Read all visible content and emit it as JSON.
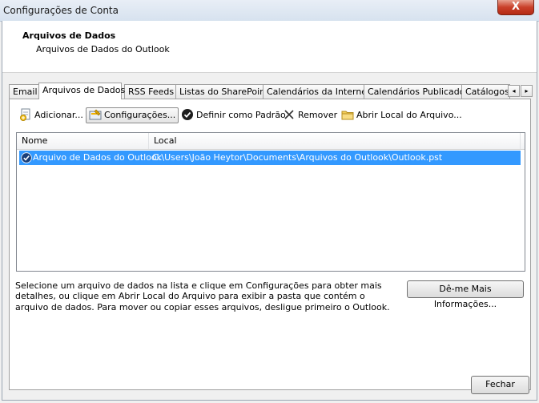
{
  "window": {
    "title": "Configurações de Conta",
    "close_glyph": "X"
  },
  "header": {
    "title": "Arquivos de Dados",
    "subtitle": "Arquivos de Dados do Outlook"
  },
  "tabs": [
    {
      "label": "Email",
      "active": false
    },
    {
      "label": "Arquivos de Dados",
      "active": true
    },
    {
      "label": "RSS Feeds",
      "active": false
    },
    {
      "label": "Listas do SharePoint",
      "active": false
    },
    {
      "label": "Calendários da Internet",
      "active": false
    },
    {
      "label": "Calendários Publicados",
      "active": false
    },
    {
      "label": "Catálogos",
      "active": false
    }
  ],
  "tab_scroll": {
    "left": "◂",
    "right": "▸"
  },
  "toolbar": {
    "add": {
      "label": "Adicionar...",
      "icon": "add-file-icon"
    },
    "settings": {
      "label": "Configurações...",
      "icon": "settings-icon"
    },
    "set_default": {
      "label": "Definir como Padrão",
      "icon": "check-circle-icon"
    },
    "remove": {
      "label": "Remover",
      "icon": "x-icon"
    },
    "open_location": {
      "label": "Abrir Local do Arquivo...",
      "icon": "folder-icon"
    }
  },
  "list": {
    "columns": [
      "Nome",
      "Local"
    ],
    "rows": [
      {
        "name": "Arquivo de Dados do Outlook",
        "location": "C:\\Users\\João Heytor\\Documents\\Arquivos do Outlook\\Outlook.pst",
        "default": true,
        "selected": true
      }
    ]
  },
  "info_text": "Selecione um arquivo de dados na lista e clique em Configurações para obter mais detalhes, ou clique em Abrir Local do Arquivo para exibir a pasta que contém o arquivo de dados. Para mover ou copiar esses arquivos, desligue primeiro o Outlook.",
  "buttons": {
    "more_info": "Dê-me Mais Informações...",
    "close": "Fechar"
  },
  "colors": {
    "selection": "#3399ff",
    "close_button": "#c9402a"
  }
}
